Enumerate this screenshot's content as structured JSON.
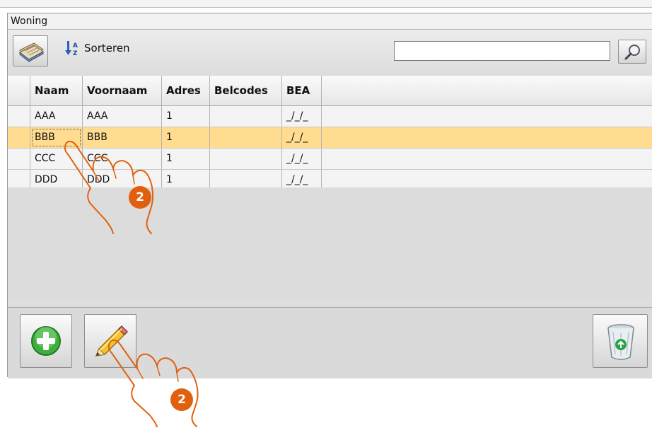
{
  "window": {
    "title": "Woning"
  },
  "toolbar": {
    "address_book_icon": "address-book-icon",
    "sort_label": "Sorteren",
    "search_value": "",
    "search_icon": "magnifier-icon"
  },
  "table": {
    "columns": [
      "Naam",
      "Voornaam",
      "Adres",
      "Belcodes",
      "BEA"
    ],
    "rows": [
      [
        "AAA",
        "AAA",
        "1",
        "",
        "_/_/_"
      ],
      [
        "BBB",
        "BBB",
        "1",
        "",
        "_/_/_"
      ],
      [
        "CCC",
        "CCC",
        "1",
        "",
        "_/_/_"
      ],
      [
        "DDD",
        "DDD",
        "1",
        "",
        "_/_/_"
      ]
    ],
    "selected_row": 1
  },
  "actions": {
    "add_icon": "plus-icon",
    "edit_icon": "pencil-icon",
    "delete_icon": "recycle-bin-icon"
  },
  "callouts": {
    "step_row": "2",
    "step_edit": "2"
  },
  "colors": {
    "selection": "#ffdc8f",
    "callout": "#e1600f"
  }
}
